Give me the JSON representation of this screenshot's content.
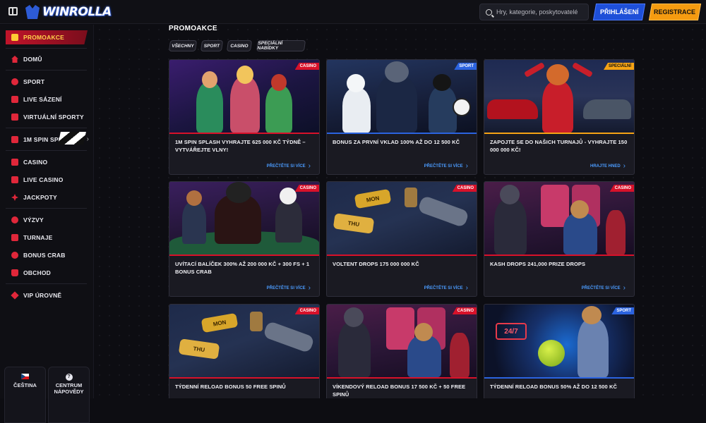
{
  "header": {
    "logo_text": "WINROLLA",
    "search_placeholder": "Hry, kategorie, poskytovatelé",
    "login_label": "PŘIHLÁŠENÍ",
    "register_label": "REGISTRACE"
  },
  "sidebar": {
    "items": [
      {
        "label": "PROMOAKCE",
        "icon": "gift-icon"
      },
      {
        "label": "DOMŮ",
        "icon": "home-icon"
      },
      {
        "label": "SPORT",
        "icon": "ball-icon"
      },
      {
        "label": "LIVE SÁZENÍ",
        "icon": "live-icon"
      },
      {
        "label": "VIRTUÁLNÍ SPORTY",
        "icon": "virtual-icon"
      },
      {
        "label": "1M SPIN SPLASH",
        "icon": "calendar-icon"
      },
      {
        "label": "CASINO",
        "icon": "slot-icon"
      },
      {
        "label": "LIVE CASINO",
        "icon": "cards-icon"
      },
      {
        "label": "JACKPOTY",
        "icon": "clover-icon"
      },
      {
        "label": "VÝZVY",
        "icon": "trophy-icon"
      },
      {
        "label": "TURNAJE",
        "icon": "cup-icon"
      },
      {
        "label": "BONUS CRAB",
        "icon": "crab-icon"
      },
      {
        "label": "OBCHOD",
        "icon": "bag-icon"
      },
      {
        "label": "VIP ÚROVNĚ",
        "icon": "diamond-icon"
      }
    ],
    "language_label": "ČEŠTINA",
    "help_label_1": "CENTRUM",
    "help_label_2": "NÁPOVĚDY"
  },
  "main": {
    "title": "PROMOAKCE",
    "filters": [
      "VŠECHNY",
      "SPORT",
      "CASINO",
      "SPECIÁLNÍ NABÍDKY"
    ],
    "cards": [
      {
        "tag": "CASINO",
        "title": "1M SPIN SPLASH VYHRAJTE 625 000 KČ TÝDNĚ – VYTVÁŘEJTE VLNY!",
        "link": "PŘEČTĚTE SI VÍCE"
      },
      {
        "tag": "SPORT",
        "title": "BONUS ZA PRVNÍ VKLAD 100% AŽ DO 12 500 KČ",
        "link": "PŘEČTĚTE SI VÍCE"
      },
      {
        "tag": "SPECIÁLNÍ",
        "title": "ZAPOJTE SE DO NAŠICH TURNAJŮ - VYHRAJTE 150 000 000 KČ!",
        "link": "HRAJTE HNED"
      },
      {
        "tag": "CASINO",
        "title": "UVÍTACÍ BALÍČEK 300% AŽ 200 000 KČ + 300 FS + 1 BONUS CRAB",
        "link": "PŘEČTĚTE SI VÍCE"
      },
      {
        "tag": "CASINO",
        "title": "VOLTENT DROPS 175 000 000 KČ",
        "link": "PŘEČTĚTE SI VÍCE"
      },
      {
        "tag": "CASINO",
        "title": "KASH DROPS 241,000 PRIZE DROPS",
        "link": "PŘEČTĚTE SI VÍCE"
      },
      {
        "tag": "CASINO",
        "title": "TÝDENNÍ RELOAD BONUS 50 FREE SPINŮ",
        "link": ""
      },
      {
        "tag": "CASINO",
        "title": "VÍKENDOVÝ RELOAD BONUS 17 500 KČ + 50 FREE SPINŮ",
        "link": ""
      },
      {
        "tag": "SPORT",
        "title": "TÝDENNÍ RELOAD BONUS 50% AŽ DO 12 500 KČ",
        "link": ""
      }
    ],
    "art_labels": {
      "mon": "MON",
      "thu": "THU",
      "sign": "24/7"
    }
  },
  "colors": {
    "accent_red": "#d8112a",
    "accent_blue": "#2b63e0",
    "accent_orange": "#f5a314",
    "link_blue": "#4b9cff"
  }
}
